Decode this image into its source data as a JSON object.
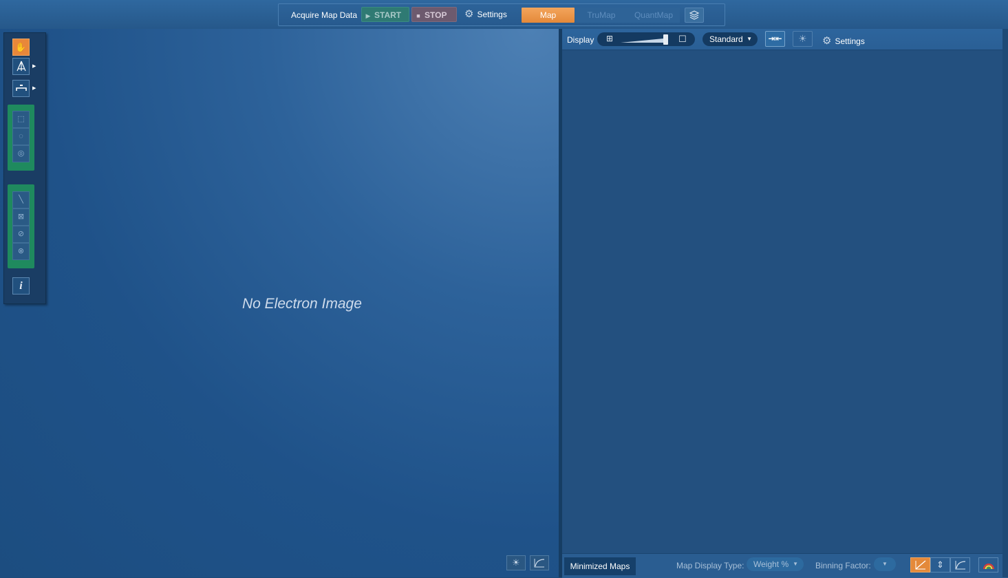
{
  "toolbar": {
    "acquire_label": "Acquire Map Data",
    "start_label": "START",
    "stop_label": "STOP",
    "settings_label": "Settings",
    "tabs": [
      {
        "label": "Map",
        "active": true
      },
      {
        "label": "TruMap",
        "active": false
      },
      {
        "label": "QuantMap",
        "active": false
      }
    ],
    "layers_icon": "layers-icon",
    "settings_icon": "gear-icon",
    "accent_color": "#e4893a"
  },
  "left_panel": {
    "placeholder": "No Electron Image",
    "tools": [
      {
        "icon": "hand-pan-icon",
        "active": true
      },
      {
        "icon": "spot-beam-icon",
        "has_submenu": true
      },
      {
        "icon": "scale-bar-icon",
        "has_submenu": true
      },
      {
        "icon": "rectangle-select-icon",
        "group": 1
      },
      {
        "icon": "ellipse-select-icon",
        "group": 1
      },
      {
        "icon": "freehand-select-icon",
        "group": 1
      },
      {
        "icon": "line-tool-icon",
        "group": 2
      },
      {
        "icon": "rectangle-region-icon",
        "group": 2
      },
      {
        "icon": "ellipse-region-icon",
        "group": 2
      },
      {
        "icon": "freehand-region-icon",
        "group": 2
      },
      {
        "icon": "info-icon",
        "label": "i"
      }
    ],
    "bottom_icons": [
      "brightness-icon",
      "curve-icon"
    ]
  },
  "right_panel": {
    "display_label": "Display",
    "display_mode": "Standard",
    "settings_label": "Settings",
    "icons": [
      "grid-icon",
      "single-view-icon",
      "fit-icon",
      "brightness-icon",
      "gear-icon"
    ],
    "minimized_maps_label": "Minimized Maps",
    "map_display_type_label": "Map Display Type:",
    "map_display_type_value": "Weight %",
    "binning_factor_label": "Binning Factor:",
    "binning_factor_value": "",
    "bottom_icons": [
      "diagonal-map-icon",
      "split-icon",
      "curve-icon",
      "rainbow-palette-icon"
    ]
  }
}
